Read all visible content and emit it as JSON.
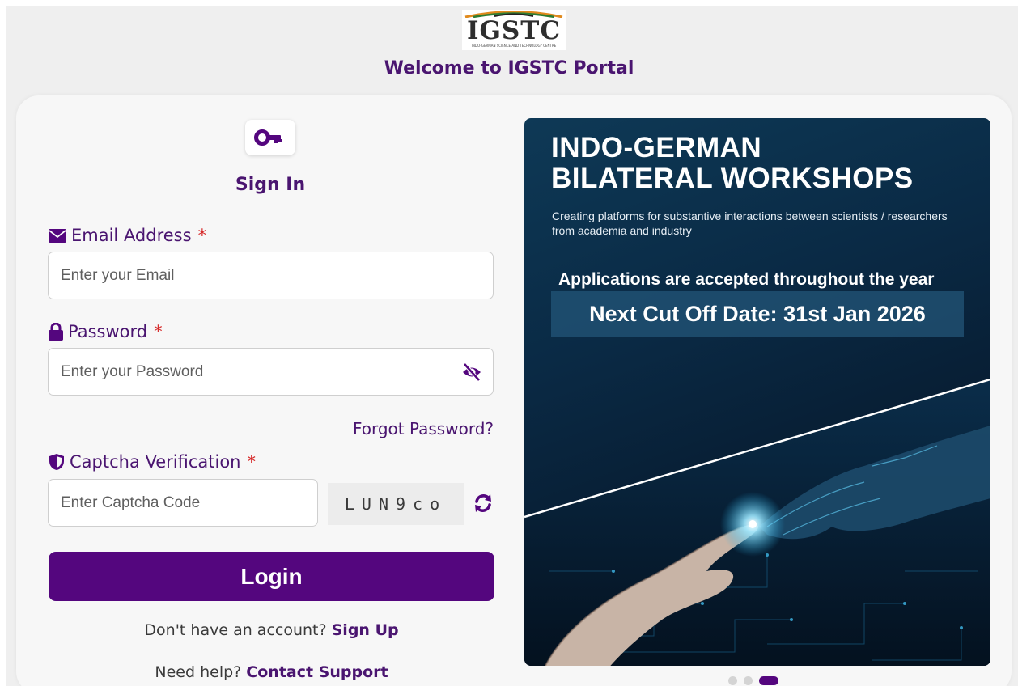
{
  "header": {
    "logo_text": "IGSTC",
    "logo_subtext": "INDO-GERMAN SCIENCE AND TECHNOLOGY CENTRE",
    "welcome": "Welcome to IGSTC Portal"
  },
  "signin": {
    "title": "Sign In",
    "email_label": "Email Address",
    "email_placeholder": "Enter your Email",
    "password_label": "Password",
    "password_placeholder": "Enter your Password",
    "forgot_password": "Forgot Password?",
    "captcha_label": "Captcha Verification",
    "captcha_placeholder": "Enter Captcha Code",
    "captcha_code": "LUN9co",
    "required_mark": "*",
    "login_button": "Login",
    "no_account_text": "Don't have an account?",
    "signup_link": "Sign Up",
    "help_text": "Need help?",
    "support_link": "Contact Support"
  },
  "banner": {
    "title_line1": "INDO-GERMAN",
    "title_line2": "BILATERAL WORKSHOPS",
    "subtitle": "Creating platforms for substantive interactions between scientists / researchers from academia and industry",
    "applications": "Applications are accepted throughout the year",
    "cutoff": "Next Cut Off Date: 31st Jan 2026"
  },
  "carousel": {
    "slide_count": 3,
    "active_slide": 3
  },
  "icons": {
    "key": "key-icon",
    "email": "envelope-icon",
    "password": "lock-icon",
    "captcha": "shield-icon",
    "toggle_password": "eye-slash-icon",
    "refresh": "refresh-icon"
  },
  "colors": {
    "brand_purple": "#54067e",
    "text_purple": "#4a1570",
    "required_red": "#d62828",
    "page_bg": "#efefef",
    "card_bg": "#f7f7f7"
  }
}
